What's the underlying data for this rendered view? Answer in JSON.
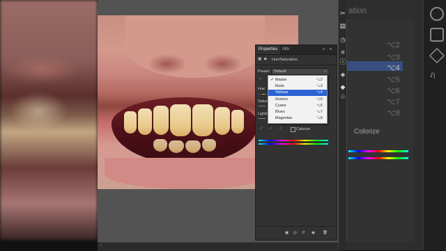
{
  "right_panel_blur": {
    "title": "ation",
    "shortcuts": [
      "⌥2",
      "⌥3",
      "⌥4",
      "⌥5",
      "⌥6",
      "⌥7",
      "⌥8"
    ],
    "colorize": "Colorize"
  },
  "properties": {
    "tabs": [
      "Properties",
      "Info"
    ],
    "adjustment_title": "Hue/Saturation",
    "preset_label": "Preset:",
    "preset_value": "Default",
    "hue_label": "Hue",
    "saturation_label": "Saturation:",
    "lightness_label": "Lightness:",
    "colorize_label": "Colorize"
  },
  "channel_dropdown": {
    "items": [
      {
        "label": "Master",
        "shortcut": "⌥2",
        "checked": true,
        "selected": false
      },
      {
        "label": "Reds",
        "shortcut": "⌥3",
        "checked": false,
        "selected": false
      },
      {
        "label": "Yellows",
        "shortcut": "⌥4",
        "checked": false,
        "selected": true
      },
      {
        "label": "Greens",
        "shortcut": "⌥5",
        "checked": false,
        "selected": false
      },
      {
        "label": "Cyans",
        "shortcut": "⌥6",
        "checked": false,
        "selected": false
      },
      {
        "label": "Blues",
        "shortcut": "⌥7",
        "checked": false,
        "selected": false
      },
      {
        "label": "Magentas",
        "shortcut": "⌥8",
        "checked": false,
        "selected": false
      }
    ]
  },
  "colors": {
    "accent": "#2b63d4",
    "panel": "#323232",
    "canvas": "#535353"
  }
}
